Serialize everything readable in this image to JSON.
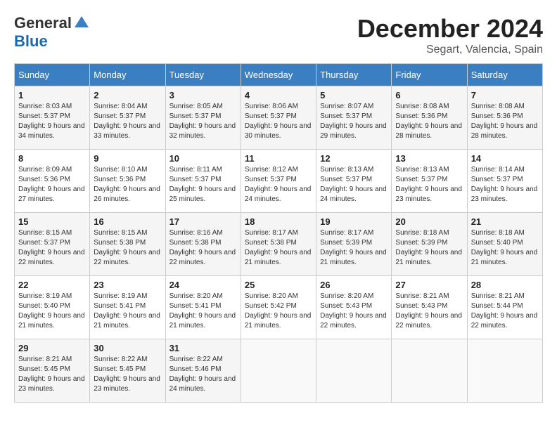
{
  "header": {
    "logo_general": "General",
    "logo_blue": "Blue",
    "title": "December 2024",
    "location": "Segart, Valencia, Spain"
  },
  "weekdays": [
    "Sunday",
    "Monday",
    "Tuesday",
    "Wednesday",
    "Thursday",
    "Friday",
    "Saturday"
  ],
  "weeks": [
    [
      {
        "day": "1",
        "sunrise": "8:03 AM",
        "sunset": "5:37 PM",
        "daylight": "9 hours and 34 minutes."
      },
      {
        "day": "2",
        "sunrise": "8:04 AM",
        "sunset": "5:37 PM",
        "daylight": "9 hours and 33 minutes."
      },
      {
        "day": "3",
        "sunrise": "8:05 AM",
        "sunset": "5:37 PM",
        "daylight": "9 hours and 32 minutes."
      },
      {
        "day": "4",
        "sunrise": "8:06 AM",
        "sunset": "5:37 PM",
        "daylight": "9 hours and 30 minutes."
      },
      {
        "day": "5",
        "sunrise": "8:07 AM",
        "sunset": "5:37 PM",
        "daylight": "9 hours and 29 minutes."
      },
      {
        "day": "6",
        "sunrise": "8:08 AM",
        "sunset": "5:36 PM",
        "daylight": "9 hours and 28 minutes."
      },
      {
        "day": "7",
        "sunrise": "8:08 AM",
        "sunset": "5:36 PM",
        "daylight": "9 hours and 28 minutes."
      }
    ],
    [
      {
        "day": "8",
        "sunrise": "8:09 AM",
        "sunset": "5:36 PM",
        "daylight": "9 hours and 27 minutes."
      },
      {
        "day": "9",
        "sunrise": "8:10 AM",
        "sunset": "5:36 PM",
        "daylight": "9 hours and 26 minutes."
      },
      {
        "day": "10",
        "sunrise": "8:11 AM",
        "sunset": "5:37 PM",
        "daylight": "9 hours and 25 minutes."
      },
      {
        "day": "11",
        "sunrise": "8:12 AM",
        "sunset": "5:37 PM",
        "daylight": "9 hours and 24 minutes."
      },
      {
        "day": "12",
        "sunrise": "8:13 AM",
        "sunset": "5:37 PM",
        "daylight": "9 hours and 24 minutes."
      },
      {
        "day": "13",
        "sunrise": "8:13 AM",
        "sunset": "5:37 PM",
        "daylight": "9 hours and 23 minutes."
      },
      {
        "day": "14",
        "sunrise": "8:14 AM",
        "sunset": "5:37 PM",
        "daylight": "9 hours and 23 minutes."
      }
    ],
    [
      {
        "day": "15",
        "sunrise": "8:15 AM",
        "sunset": "5:37 PM",
        "daylight": "9 hours and 22 minutes."
      },
      {
        "day": "16",
        "sunrise": "8:15 AM",
        "sunset": "5:38 PM",
        "daylight": "9 hours and 22 minutes."
      },
      {
        "day": "17",
        "sunrise": "8:16 AM",
        "sunset": "5:38 PM",
        "daylight": "9 hours and 22 minutes."
      },
      {
        "day": "18",
        "sunrise": "8:17 AM",
        "sunset": "5:38 PM",
        "daylight": "9 hours and 21 minutes."
      },
      {
        "day": "19",
        "sunrise": "8:17 AM",
        "sunset": "5:39 PM",
        "daylight": "9 hours and 21 minutes."
      },
      {
        "day": "20",
        "sunrise": "8:18 AM",
        "sunset": "5:39 PM",
        "daylight": "9 hours and 21 minutes."
      },
      {
        "day": "21",
        "sunrise": "8:18 AM",
        "sunset": "5:40 PM",
        "daylight": "9 hours and 21 minutes."
      }
    ],
    [
      {
        "day": "22",
        "sunrise": "8:19 AM",
        "sunset": "5:40 PM",
        "daylight": "9 hours and 21 minutes."
      },
      {
        "day": "23",
        "sunrise": "8:19 AM",
        "sunset": "5:41 PM",
        "daylight": "9 hours and 21 minutes."
      },
      {
        "day": "24",
        "sunrise": "8:20 AM",
        "sunset": "5:41 PM",
        "daylight": "9 hours and 21 minutes."
      },
      {
        "day": "25",
        "sunrise": "8:20 AM",
        "sunset": "5:42 PM",
        "daylight": "9 hours and 21 minutes."
      },
      {
        "day": "26",
        "sunrise": "8:20 AM",
        "sunset": "5:43 PM",
        "daylight": "9 hours and 22 minutes."
      },
      {
        "day": "27",
        "sunrise": "8:21 AM",
        "sunset": "5:43 PM",
        "daylight": "9 hours and 22 minutes."
      },
      {
        "day": "28",
        "sunrise": "8:21 AM",
        "sunset": "5:44 PM",
        "daylight": "9 hours and 22 minutes."
      }
    ],
    [
      {
        "day": "29",
        "sunrise": "8:21 AM",
        "sunset": "5:45 PM",
        "daylight": "9 hours and 23 minutes."
      },
      {
        "day": "30",
        "sunrise": "8:22 AM",
        "sunset": "5:45 PM",
        "daylight": "9 hours and 23 minutes."
      },
      {
        "day": "31",
        "sunrise": "8:22 AM",
        "sunset": "5:46 PM",
        "daylight": "9 hours and 24 minutes."
      },
      null,
      null,
      null,
      null
    ]
  ]
}
